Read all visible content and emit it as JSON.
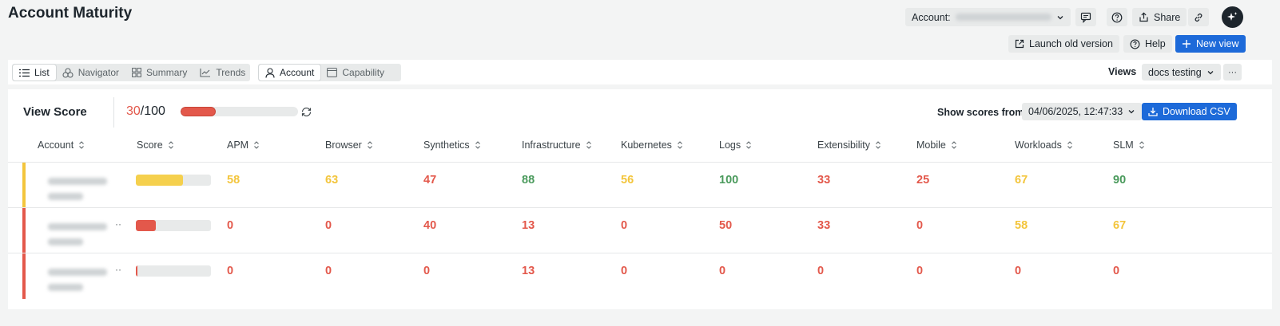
{
  "page": {
    "title": "Account Maturity"
  },
  "header": {
    "account_label": "Account:",
    "share_label": "Share",
    "launch_old_label": "Launch old version",
    "help_label": "Help",
    "new_view_label": "New view"
  },
  "toolbar": {
    "view_tabs": [
      "List",
      "Navigator",
      "Summary",
      "Trends"
    ],
    "scope_tabs": [
      "Account",
      "Capability"
    ],
    "views_label": "Views",
    "views_value": "docs testing",
    "more_label": "···"
  },
  "score_panel": {
    "title": "View Score",
    "score": "30",
    "score_total": "/100",
    "score_fraction": 0.3,
    "show_scores_label": "Show scores from",
    "date_value": "04/06/2025, 12:47:33",
    "download_label": "Download CSV"
  },
  "table": {
    "columns": [
      "Account",
      "Score",
      "APM",
      "Browser",
      "Synthetics",
      "Infrastructure",
      "Kubernetes",
      "Logs",
      "Extensibility",
      "Mobile",
      "Workloads",
      "SLM"
    ],
    "rows": [
      {
        "more": "",
        "stripe": "#f3c53c",
        "score_fraction": 0.63,
        "score_color": "#f5d04d",
        "values": [
          "58",
          "63",
          "47",
          "88",
          "56",
          "100",
          "33",
          "25",
          "67",
          "90"
        ],
        "tones": [
          "yellow",
          "yellow",
          "red",
          "green",
          "yellow",
          "green",
          "red",
          "red",
          "yellow",
          "green"
        ]
      },
      {
        "more": "··",
        "stripe": "#e3584b",
        "score_fraction": 0.27,
        "score_color": "#e3584b",
        "values": [
          "0",
          "0",
          "40",
          "13",
          "0",
          "50",
          "33",
          "0",
          "58",
          "67"
        ],
        "tones": [
          "red",
          "red",
          "red",
          "red",
          "red",
          "red",
          "red",
          "red",
          "yellow",
          "yellow"
        ]
      },
      {
        "more": "··",
        "stripe": "#e3584b",
        "score_fraction": 0.02,
        "score_color": "#e3584b",
        "values": [
          "0",
          "0",
          "0",
          "13",
          "0",
          "0",
          "0",
          "0",
          "0",
          "0"
        ],
        "tones": [
          "red",
          "red",
          "red",
          "red",
          "red",
          "red",
          "red",
          "red",
          "red",
          "red"
        ]
      }
    ]
  },
  "colors": {
    "accent": "#1d6ad9",
    "red": "#e3584b",
    "yellow": "#f3c53c",
    "green": "#4a9a5c"
  }
}
